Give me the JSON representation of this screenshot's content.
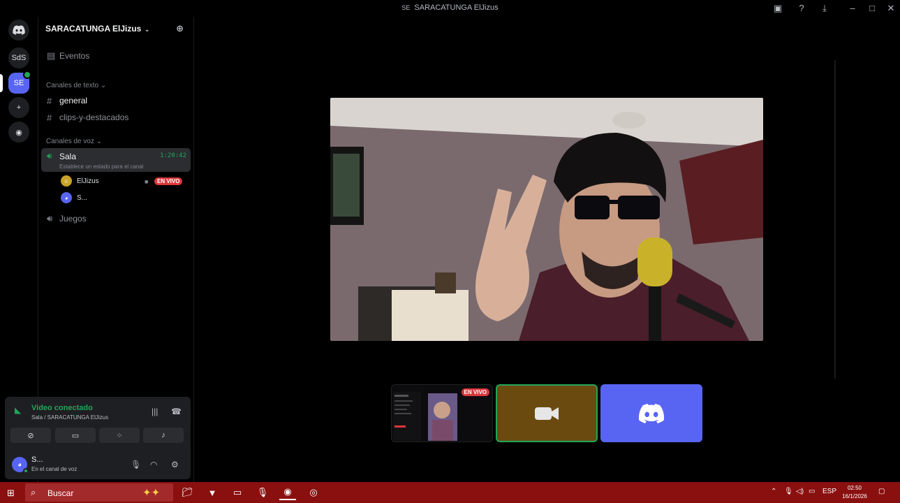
{
  "window": {
    "title": "SARACATUNGA ElJizus",
    "icons": [
      "inbox-icon",
      "help-icon",
      "download-icon",
      "minimize-icon",
      "maximize-icon",
      "close-icon"
    ]
  },
  "rail": {
    "servers": [
      {
        "name": "discord-home",
        "label": ""
      },
      {
        "name": "server-sds",
        "label": "SdS"
      },
      {
        "name": "server-se",
        "label": "SE"
      },
      {
        "name": "add-server",
        "label": ""
      },
      {
        "name": "discover",
        "label": ""
      }
    ]
  },
  "server": {
    "name": "SARACATUNGA ElJizus",
    "events": "Eventos",
    "text_category": "Canales de texto",
    "text_channels": [
      "general",
      "clips-y-destacados"
    ],
    "voice_category": "Canales de voz",
    "voice_active": {
      "name": "Sala",
      "timer": "1:20:42",
      "status": "Establece un estado para el canal"
    },
    "members": [
      {
        "name": "ElJizus",
        "badge": "EN VIVO",
        "avatar_color": "#c9a227"
      },
      {
        "name": "S...",
        "badge": "",
        "avatar_color": "#5865f2"
      }
    ],
    "voice_other": "Juegos"
  },
  "voice_panel": {
    "title": "Video conectado",
    "subtitle": "Sala / SARACATUNGA ElJizus",
    "user_name": "S...",
    "user_status": "En el canal de voz"
  },
  "stage": {
    "tile_badge": "EN VIVO"
  },
  "taskbar": {
    "search_placeholder": "Buscar",
    "lang": "ESP",
    "time": "02:50",
    "date": "16/1/2026"
  },
  "colors": {
    "accent": "#5865f2",
    "online": "#23a55a",
    "live": "#da373c",
    "taskbar": "#8a1010"
  }
}
